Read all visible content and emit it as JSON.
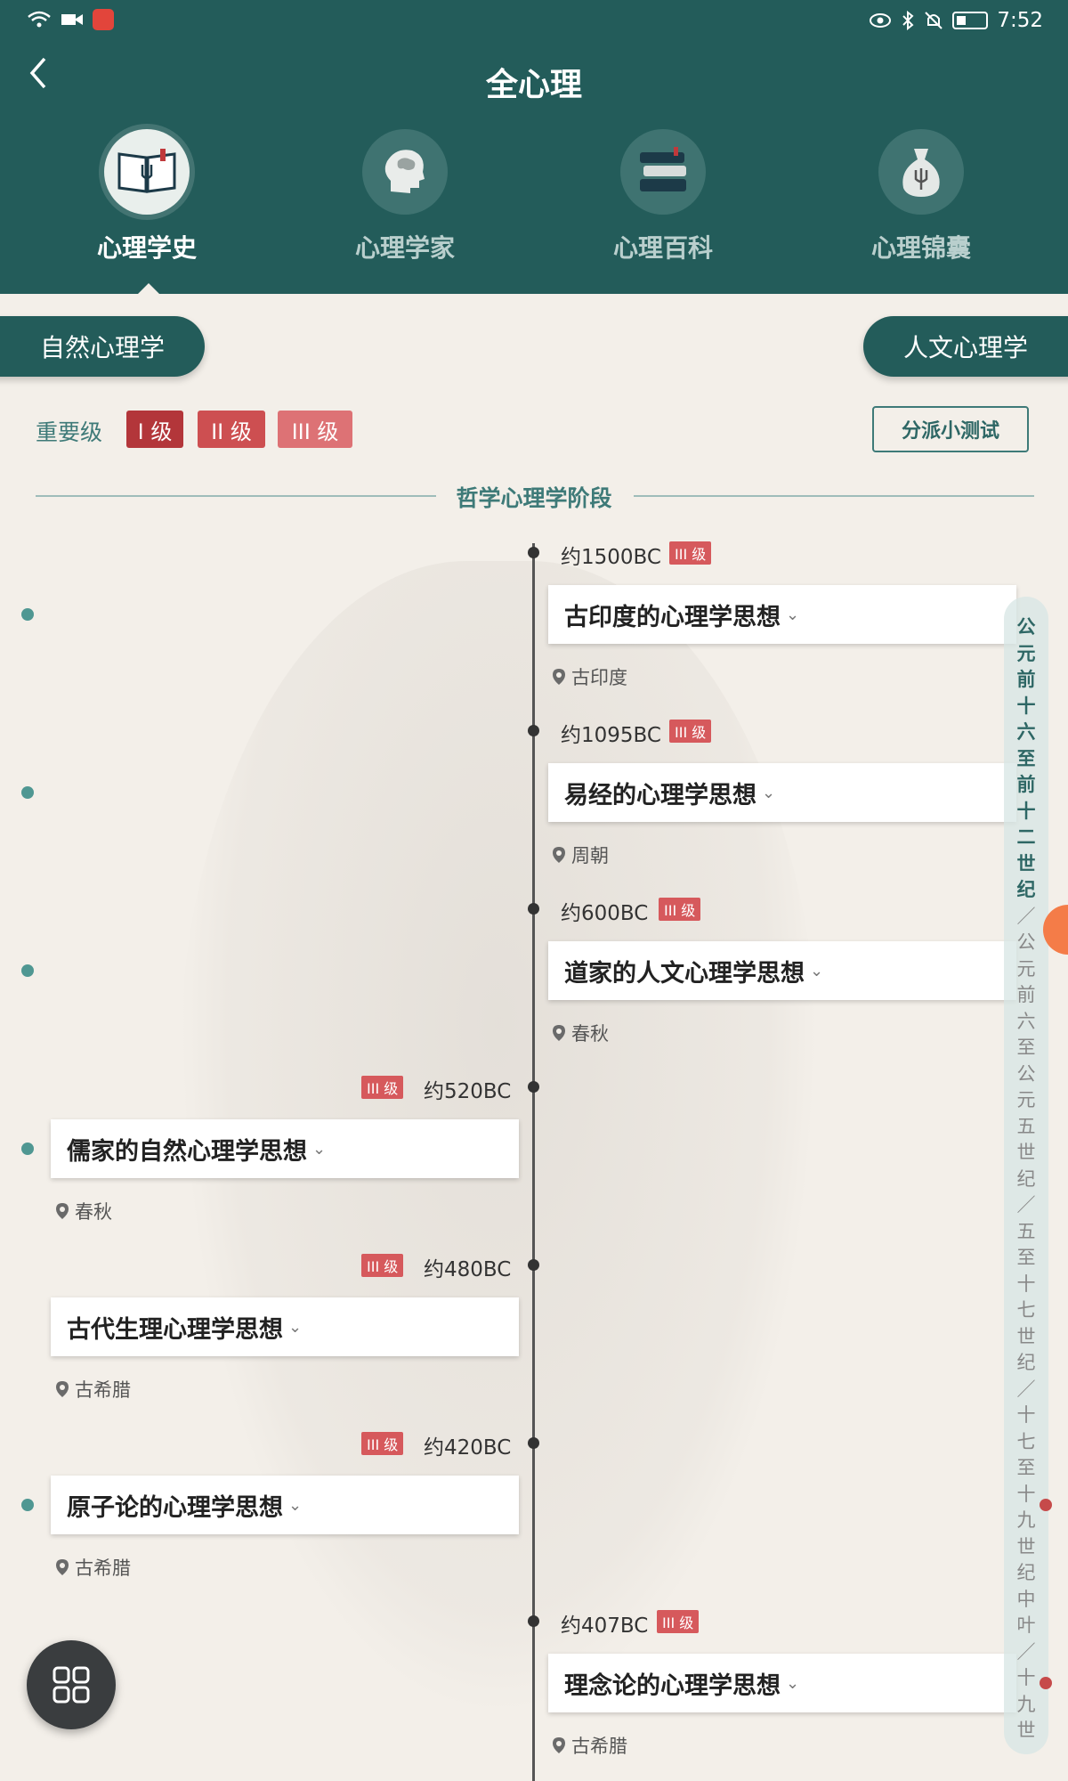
{
  "status_bar": {
    "time": "7:52"
  },
  "header": {
    "title": "全心理",
    "back_icon": "chevron-left-icon"
  },
  "nav": [
    {
      "label": "心理学史",
      "icon": "book-icon",
      "active": true
    },
    {
      "label": "心理学家",
      "icon": "brain-head-icon",
      "active": false
    },
    {
      "label": "心理百科",
      "icon": "books-stack-icon",
      "active": false
    },
    {
      "label": "心理锦囊",
      "icon": "pouch-icon",
      "active": false
    }
  ],
  "categories": {
    "left": "自然心理学",
    "right": "人文心理学"
  },
  "importance": {
    "label": "重要级",
    "levels": [
      {
        "label": "I 级",
        "color": "#b3363a"
      },
      {
        "label": "II 级",
        "color": "#cd4f51"
      },
      {
        "label": "III 级",
        "color": "#dd7275"
      }
    ]
  },
  "quiz_button": "分派小测试",
  "stage": {
    "title": "哲学心理学阶段"
  },
  "events": [
    {
      "date": "约1500BC",
      "level": "III 级",
      "title": "古印度的心理学思想",
      "location": "古印度",
      "side": "right"
    },
    {
      "date": "约1095BC",
      "level": "III 级",
      "title": "易经的心理学思想",
      "location": "周朝",
      "side": "right"
    },
    {
      "date": "约600BC",
      "level": "III 级",
      "title": "道家的人文心理学思想",
      "location": "春秋",
      "side": "right"
    },
    {
      "date": "约520BC",
      "level": "III 级",
      "title": "儒家的自然心理学思想",
      "location": "春秋",
      "side": "left"
    },
    {
      "date": "约480BC",
      "level": "III 级",
      "title": "古代生理心理学思想",
      "location": "古希腊",
      "side": "left"
    },
    {
      "date": "约420BC",
      "level": "III 级",
      "title": "原子论的心理学思想",
      "location": "古希腊",
      "side": "left"
    },
    {
      "date": "约407BC",
      "level": "III 级",
      "title": "理念论的心理学思想",
      "location": "古希腊",
      "side": "right"
    }
  ],
  "era_index": {
    "active": "公元前十六至前十二世纪",
    "rest": "／公元前六至公元五世纪／五至十七世纪／十七至十九世纪中叶／十九世"
  },
  "colors": {
    "primary": "#235c5a",
    "accent": "#3e7a78",
    "tag": "#d6595c"
  }
}
